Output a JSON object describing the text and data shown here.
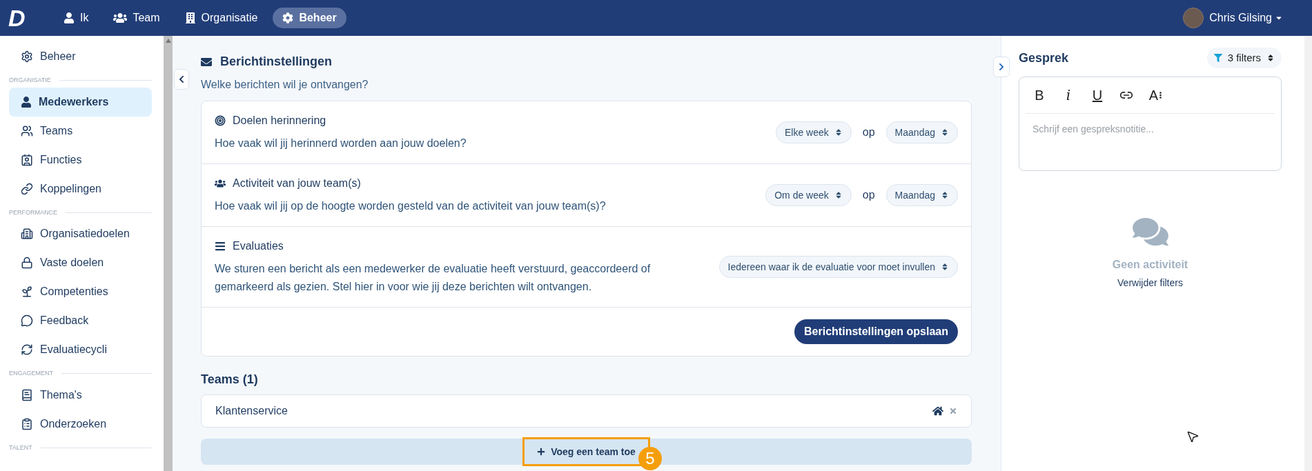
{
  "nav": {
    "logo": "D",
    "items": [
      {
        "label": "Ik",
        "kind": "user",
        "selected": false
      },
      {
        "label": "Team",
        "kind": "users",
        "selected": false
      },
      {
        "label": "Organisatie",
        "kind": "building",
        "selected": false
      },
      {
        "label": "Beheer",
        "kind": "gear",
        "selected": true
      }
    ],
    "user": {
      "name": "Chris Gilsing"
    }
  },
  "sidebar": {
    "sections": [
      {
        "items": [
          {
            "label": "Beheer",
            "kind": "gear",
            "selected": false
          }
        ]
      },
      {
        "heading": "ORGANISATIE",
        "items": [
          {
            "label": "Medewerkers",
            "kind": "user",
            "selected": true
          },
          {
            "label": "Teams",
            "kind": "users",
            "selected": false
          },
          {
            "label": "Functies",
            "kind": "idcard",
            "selected": false
          },
          {
            "label": "Koppelingen",
            "kind": "link",
            "selected": false
          }
        ]
      },
      {
        "heading": "PERFORMANCE",
        "items": [
          {
            "label": "Organisatiedoelen",
            "kind": "building",
            "selected": false
          },
          {
            "label": "Vaste doelen",
            "kind": "lock",
            "selected": false
          },
          {
            "label": "Competenties",
            "kind": "sprout",
            "selected": false
          },
          {
            "label": "Feedback",
            "kind": "chat",
            "selected": false
          },
          {
            "label": "Evaluatiecycli",
            "kind": "cycle",
            "selected": false
          }
        ]
      },
      {
        "heading": "ENGAGEMENT",
        "items": [
          {
            "label": "Thema's",
            "kind": "book",
            "selected": false
          },
          {
            "label": "Onderzoeken",
            "kind": "clipboard",
            "selected": false
          }
        ]
      },
      {
        "heading": "TALENT"
      }
    ]
  },
  "main": {
    "title": "Berichtinstellingen",
    "subtitle": "Welke berichten wil je ontvangen?",
    "settings": [
      {
        "kind": "target",
        "title": "Doelen herinnering",
        "question": "Hoe vaak wil jij herinnerd worden aan jouw doelen?",
        "selects": [
          {
            "value": "Elke week"
          },
          {
            "value": "Maandag"
          }
        ],
        "joiner": "op"
      },
      {
        "kind": "users",
        "title": "Activiteit van jouw team(s)",
        "question": "Hoe vaak wil jij op de hoogte worden gesteld van de activiteit van jouw team(s)?",
        "selects": [
          {
            "value": "Om de week"
          },
          {
            "value": "Maandag"
          }
        ],
        "joiner": "op"
      },
      {
        "kind": "list",
        "title": "Evaluaties",
        "question": "We sturen een bericht als een medewerker de evaluatie heeft verstuurd, geaccordeerd of gemarkeerd als gezien. Stel hier in voor wie jij deze berichten wilt ontvangen.",
        "selects": [
          {
            "value": "Iedereen waar ik de evaluatie voor moet invullen"
          }
        ]
      }
    ],
    "save_button": "Berichtinstellingen opslaan",
    "teams_heading": "Teams (1)",
    "teams": [
      {
        "name": "Klantenservice"
      }
    ],
    "add_button": "Voeg een team toe",
    "step_badge": "5"
  },
  "panel": {
    "title": "Gesprek",
    "filter": "3 filters",
    "toolbar": [
      {
        "kind": "bold",
        "label": "B"
      },
      {
        "kind": "italic",
        "label": "i"
      },
      {
        "kind": "underline",
        "label": "U"
      },
      {
        "kind": "link"
      },
      {
        "kind": "size",
        "label": "A"
      }
    ],
    "placeholder": "Schrijf een gespreksnotitie...",
    "empty_title": "Geen activiteit",
    "empty_link": "Verwijder filters"
  }
}
